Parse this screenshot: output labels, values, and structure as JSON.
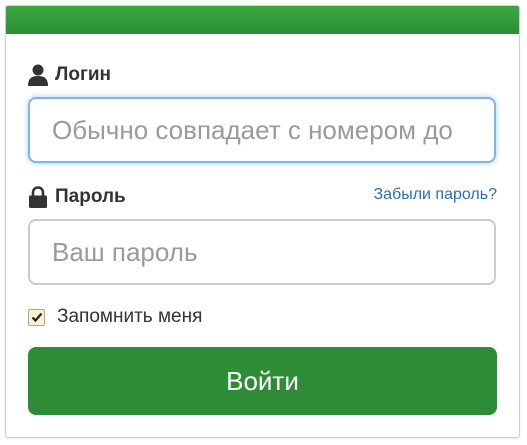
{
  "header": {
    "accent_color": "#2e8b36"
  },
  "login": {
    "label": "Логин",
    "icon": "user-icon",
    "placeholder": "Обычно совпадает с номером до",
    "value": ""
  },
  "password": {
    "label": "Пароль",
    "icon": "lock-icon",
    "placeholder": "Ваш пароль",
    "value": "",
    "forgot_link": "Забыли пароль?"
  },
  "remember": {
    "label": "Запомнить меня",
    "checked": true
  },
  "submit": {
    "label": "Войти"
  }
}
